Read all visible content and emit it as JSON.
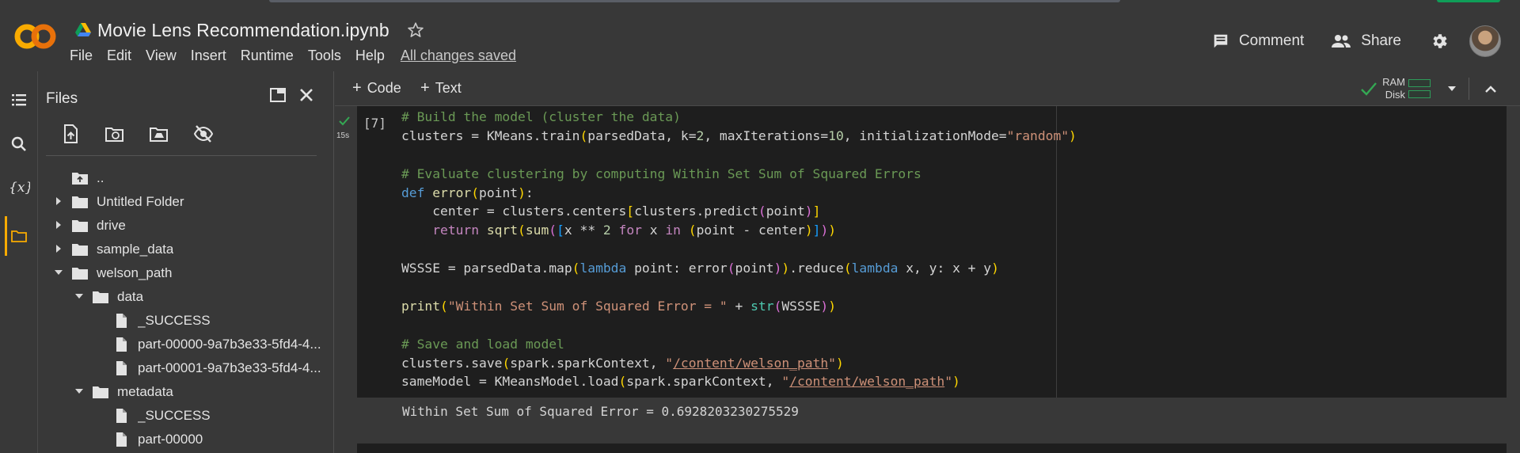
{
  "app": {
    "notebook_title": "Movie Lens Recommendation.ipynb",
    "menu": [
      "File",
      "Edit",
      "View",
      "Insert",
      "Runtime",
      "Tools",
      "Help"
    ],
    "save_status": "All changes saved",
    "logo_text": "CO"
  },
  "header_actions": {
    "comment_label": "Comment",
    "share_label": "Share"
  },
  "files_panel": {
    "title": "Files",
    "tree": [
      {
        "label": "..",
        "type": "folder-up",
        "depth": 0,
        "caret": "none"
      },
      {
        "label": "Untitled Folder",
        "type": "folder",
        "depth": 0,
        "caret": "collapsed"
      },
      {
        "label": "drive",
        "type": "folder",
        "depth": 0,
        "caret": "collapsed"
      },
      {
        "label": "sample_data",
        "type": "folder",
        "depth": 0,
        "caret": "collapsed"
      },
      {
        "label": "welson_path",
        "type": "folder",
        "depth": 0,
        "caret": "expanded"
      },
      {
        "label": "data",
        "type": "folder",
        "depth": 1,
        "caret": "expanded"
      },
      {
        "label": "_SUCCESS",
        "type": "file",
        "depth": 2,
        "caret": "none"
      },
      {
        "label": "part-00000-9a7b3e33-5fd4-4...",
        "type": "file",
        "depth": 2,
        "caret": "none"
      },
      {
        "label": "part-00001-9a7b3e33-5fd4-4...",
        "type": "file",
        "depth": 2,
        "caret": "none"
      },
      {
        "label": "metadata",
        "type": "folder",
        "depth": 1,
        "caret": "expanded"
      },
      {
        "label": "_SUCCESS",
        "type": "file",
        "depth": 2,
        "caret": "none"
      },
      {
        "label": "part-00000",
        "type": "file",
        "depth": 2,
        "caret": "none"
      }
    ]
  },
  "toolbar": {
    "add_code_label": "Code",
    "add_text_label": "Text",
    "ram_label": "RAM",
    "disk_label": "Disk"
  },
  "cell": {
    "execution_count": "[7]",
    "run_time": "15s",
    "lines": [
      [
        [
          "c-com",
          "# Build the model (cluster the data)"
        ]
      ],
      [
        [
          "",
          "clusters = KMeans.train"
        ],
        [
          "c-p1",
          "("
        ],
        [
          "",
          "parsedData, k="
        ],
        [
          "c-num",
          "2"
        ],
        [
          "",
          ", maxIterations="
        ],
        [
          "c-num",
          "10"
        ],
        [
          "",
          ", initializationMode="
        ],
        [
          "c-str",
          "\"random\""
        ],
        [
          "c-p1",
          ")"
        ]
      ],
      [],
      [
        [
          "c-com",
          "# Evaluate clustering by computing Within Set Sum of Squared Errors"
        ]
      ],
      [
        [
          "c-kw",
          "def "
        ],
        [
          "c-fn",
          "error"
        ],
        [
          "c-p1",
          "("
        ],
        [
          "",
          "point"
        ],
        [
          "c-p1",
          ")"
        ],
        [
          "",
          ":"
        ]
      ],
      [
        [
          "",
          "    center = clusters.centers"
        ],
        [
          "c-p1",
          "["
        ],
        [
          "",
          "clusters.predict"
        ],
        [
          "c-p2",
          "("
        ],
        [
          "",
          "point"
        ],
        [
          "c-p2",
          ")"
        ],
        [
          "c-p1",
          "]"
        ]
      ],
      [
        [
          "c-ctl",
          "    return "
        ],
        [
          "c-fn",
          "sqrt"
        ],
        [
          "c-p1",
          "("
        ],
        [
          "c-fn",
          "sum"
        ],
        [
          "c-p2",
          "("
        ],
        [
          "c-p3",
          "["
        ],
        [
          "",
          "x ** "
        ],
        [
          "c-num",
          "2"
        ],
        [
          "c-ctl",
          " for "
        ],
        [
          "",
          "x "
        ],
        [
          "c-ctl",
          "in "
        ],
        [
          "c-p1",
          "("
        ],
        [
          "",
          "point - center"
        ],
        [
          "c-p1",
          ")"
        ],
        [
          "c-p3",
          "]"
        ],
        [
          "c-p2",
          ")"
        ],
        [
          "c-p1",
          ")"
        ]
      ],
      [],
      [
        [
          "",
          "WSSSE = parsedData.map"
        ],
        [
          "c-p1",
          "("
        ],
        [
          "c-kw",
          "lambda "
        ],
        [
          "",
          "point: error"
        ],
        [
          "c-p2",
          "("
        ],
        [
          "",
          "point"
        ],
        [
          "c-p2",
          ")"
        ],
        [
          "c-p1",
          ")"
        ],
        [
          "",
          ".reduce"
        ],
        [
          "c-p1",
          "("
        ],
        [
          "c-kw",
          "lambda "
        ],
        [
          "",
          "x, y: x + y"
        ],
        [
          "c-p1",
          ")"
        ]
      ],
      [],
      [
        [
          "c-fn",
          "print"
        ],
        [
          "c-p1",
          "("
        ],
        [
          "c-str",
          "\"Within Set Sum of Squared Error = \""
        ],
        [
          "",
          " + "
        ],
        [
          "c-bi",
          "str"
        ],
        [
          "c-p2",
          "("
        ],
        [
          "",
          "WSSSE"
        ],
        [
          "c-p2",
          ")"
        ],
        [
          "c-p1",
          ")"
        ]
      ],
      [],
      [
        [
          "c-com",
          "# Save and load model"
        ]
      ],
      [
        [
          "",
          "clusters.save"
        ],
        [
          "c-p1",
          "("
        ],
        [
          "",
          "spark.sparkContext, "
        ],
        [
          "c-str",
          "\""
        ],
        [
          "c-str u",
          "/content/welson_path"
        ],
        [
          "c-str",
          "\""
        ],
        [
          "c-p1",
          ")"
        ]
      ],
      [
        [
          "",
          "sameModel = KMeansModel.load"
        ],
        [
          "c-p1",
          "("
        ],
        [
          "",
          "spark.sparkContext, "
        ],
        [
          "c-str",
          "\""
        ],
        [
          "c-str u",
          "/content/welson_path"
        ],
        [
          "c-str",
          "\""
        ],
        [
          "c-p1",
          ")"
        ]
      ]
    ],
    "output": "Within Set Sum of Squared Error = 0.6928203230275529"
  }
}
